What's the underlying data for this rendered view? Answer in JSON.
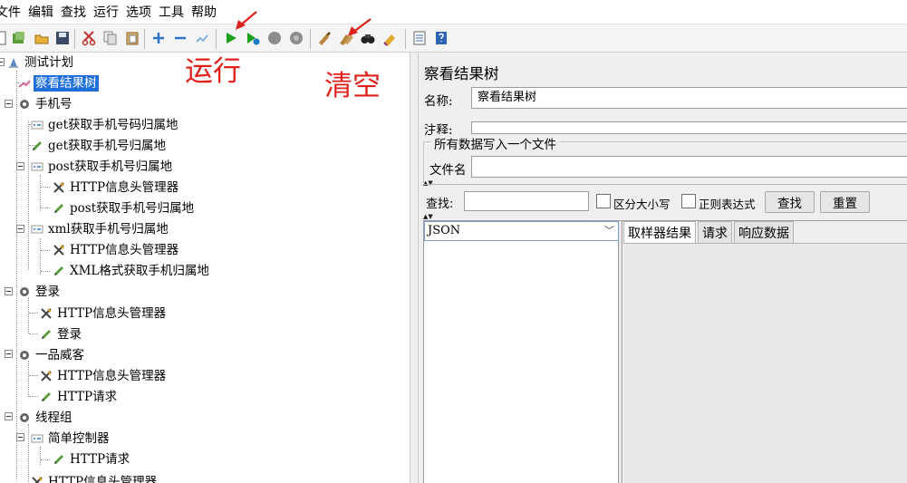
{
  "menu": [
    "文件",
    "编辑",
    "查找",
    "运行",
    "选项",
    "工具",
    "帮助"
  ],
  "annotations": {
    "run": "运行",
    "clear": "清空"
  },
  "toolbar_icons": [
    "new-file-icon",
    "templates-icon",
    "open-icon",
    "save-icon",
    "cut-icon",
    "copy-icon",
    "paste-icon",
    "expand-icon",
    "collapse-icon",
    "toggle-icon",
    "start-icon",
    "start-no-pause-icon",
    "stop-icon",
    "shutdown-icon",
    "clear-icon",
    "clear-all-icon",
    "search-icon",
    "reset-search-icon",
    "function-helper-icon",
    "help-icon"
  ],
  "tree": {
    "items": [
      {
        "label": "测试计划",
        "icon": "test-plan-icon"
      },
      {
        "label": "察看结果树",
        "icon": "listener-icon",
        "selected": true
      },
      {
        "label": "手机号",
        "icon": "thread-group-icon"
      },
      {
        "label": "get获取手机号码归属地",
        "icon": "controller-icon"
      },
      {
        "label": "get获取手机号归属地",
        "icon": "sampler-icon"
      },
      {
        "label": "post获取手机号归属地",
        "icon": "controller-icon"
      },
      {
        "label": "HTTP信息头管理器",
        "icon": "config-icon"
      },
      {
        "label": "post获取手机号归属地",
        "icon": "sampler-icon"
      },
      {
        "label": "xml获取手机号归属地",
        "icon": "controller-icon"
      },
      {
        "label": "HTTP信息头管理器",
        "icon": "config-icon"
      },
      {
        "label": "XML格式获取手机归属地",
        "icon": "sampler-icon"
      },
      {
        "label": "登录",
        "icon": "thread-group-icon"
      },
      {
        "label": "HTTP信息头管理器",
        "icon": "config-icon"
      },
      {
        "label": "登录",
        "icon": "sampler-icon"
      },
      {
        "label": "一品威客",
        "icon": "thread-group-icon"
      },
      {
        "label": "HTTP信息头管理器",
        "icon": "config-icon"
      },
      {
        "label": "HTTP请求",
        "icon": "sampler-icon"
      },
      {
        "label": "线程组",
        "icon": "thread-group-icon"
      },
      {
        "label": "简单控制器",
        "icon": "controller-icon"
      },
      {
        "label": "HTTP请求",
        "icon": "sampler-icon"
      },
      {
        "label": "HTTP信息头管理器",
        "icon": "config-icon"
      }
    ]
  },
  "panel": {
    "title": "察看结果树",
    "name_label": "名称:",
    "name_value": "察看结果树",
    "comment_label": "注释:",
    "comment_value": "",
    "fieldset_legend": "所有数据写入一个文件",
    "filename_label": "文件名",
    "filename_value": "",
    "search_label": "查找:",
    "search_value": "",
    "case_label": "区分大小写",
    "regex_label": "正则表达式",
    "find_button": "查找",
    "reset_button": "重置",
    "renderer_selected": "JSON",
    "tabs": [
      "取样器结果",
      "请求",
      "响应数据"
    ]
  },
  "colors": {
    "selection": "#1e6fd9",
    "annotation": "#e0201a",
    "run_green": "#1aa01a"
  }
}
